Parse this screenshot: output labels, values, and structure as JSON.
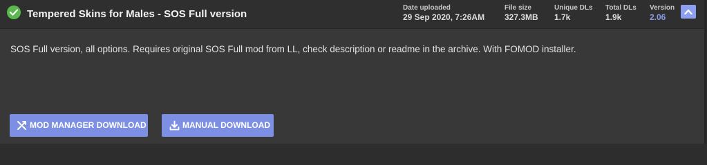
{
  "file": {
    "title": "Tempered Skins for Males - SOS Full version",
    "status_icon": "check-circle-icon",
    "status_color": "#5ab84e",
    "description": "SOS Full version, all options. Requires original SOS Full mod from LL, check description or readme in the archive. With FOMOD installer."
  },
  "stats": {
    "date_uploaded": {
      "label": "Date uploaded",
      "value": "29 Sep 2020, 7:26AM"
    },
    "file_size": {
      "label": "File size",
      "value": "327.3MB"
    },
    "unique_dls": {
      "label": "Unique DLs",
      "value": "1.7k"
    },
    "total_dls": {
      "label": "Total DLs",
      "value": "1.9k"
    },
    "version": {
      "label": "Version",
      "value": "2.06"
    }
  },
  "collapse_button": {
    "icon": "chevron-up-icon"
  },
  "actions": {
    "mod_manager": {
      "label": "MOD MANAGER DOWNLOAD",
      "icon": "vortex-icon"
    },
    "manual": {
      "label": "MANUAL DOWNLOAD",
      "icon": "download-icon"
    }
  },
  "colors": {
    "accent": "#7c8fe3",
    "version_text": "#8a9be6",
    "background": "#383838",
    "header_background": "#2f2f2f"
  }
}
